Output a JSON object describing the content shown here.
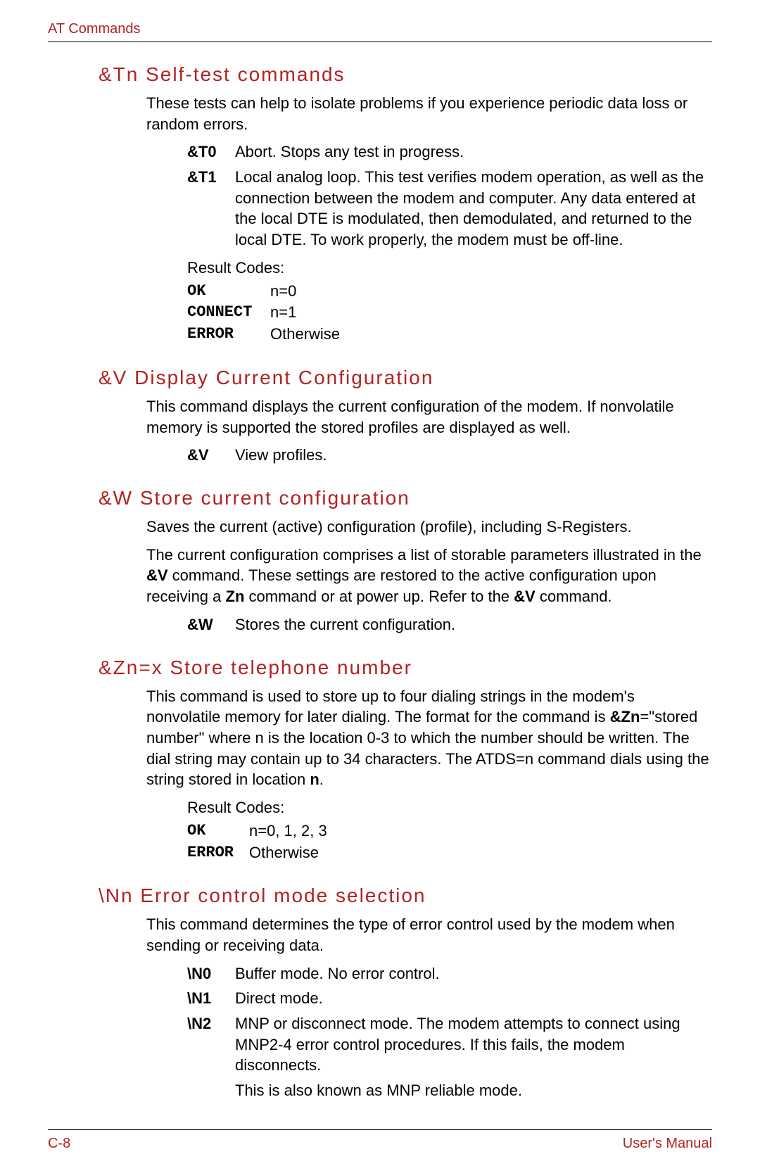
{
  "header": {
    "title": "AT Commands"
  },
  "footer": {
    "page": "C-8",
    "doc": "User's Manual"
  },
  "sections": {
    "tn": {
      "heading": "&Tn   Self-test commands",
      "intro": "These tests can help to isolate problems if you experience periodic data loss or random errors.",
      "items": [
        {
          "term": "&T0",
          "desc": "Abort. Stops any test in progress."
        },
        {
          "term": "&T1",
          "desc": "Local analog loop. This test verifies modem operation, as well as the connection between the modem and computer. Any data entered at the local DTE is modulated, then demodulated, and returned to the local DTE. To work properly, the modem must be off-line."
        }
      ],
      "result_label": "Result Codes:",
      "results": [
        {
          "code": "OK",
          "val": "n=0"
        },
        {
          "code": "CONNECT",
          "val": "n=1"
        },
        {
          "code": "ERROR",
          "val": "Otherwise"
        }
      ]
    },
    "v": {
      "heading": "&V    Display Current Configuration",
      "intro": "This command displays the current configuration of the modem. If nonvolatile memory is supported the stored profiles are displayed as well.",
      "items": [
        {
          "term": "&V",
          "desc": "View profiles."
        }
      ]
    },
    "w": {
      "heading": "&W   Store current configuration",
      "intro": "Saves the current (active) configuration (profile), including S-Registers.",
      "para2_pre": "The current configuration comprises a list of storable parameters illustrated in the ",
      "para2_b1": "&V",
      "para2_mid": " command. These settings are restored to the active configuration upon receiving a ",
      "para2_b2": "Zn",
      "para2_mid2": " command or at power up. Refer to the ",
      "para2_b3": "&V",
      "para2_end": " command.",
      "items": [
        {
          "term": "&W",
          "desc": "Stores the current configuration."
        }
      ]
    },
    "zn": {
      "heading": "&Zn=x   Store telephone number",
      "p_pre": "This command is used to store up to four dialing strings in the modem's nonvolatile memory for later dialing. The format for the command is ",
      "p_b1": "&Zn",
      "p_mid": "=\"stored number\" where n is the location 0-3 to which the number should be written. The dial string may contain up to 34 characters. The ATDS=n command dials using the string stored in location ",
      "p_b2": "n",
      "p_end": ".",
      "result_label": "Result Codes:",
      "results": [
        {
          "code": "OK",
          "val": "n=0, 1, 2, 3"
        },
        {
          "code": "ERROR",
          "val": "Otherwise"
        }
      ]
    },
    "nn": {
      "heading": "\\Nn    Error control mode selection",
      "intro": "This command determines the type of error control used by the modem when sending or receiving data.",
      "items": [
        {
          "term": "\\N0",
          "desc": "Buffer mode. No error control."
        },
        {
          "term": "\\N1",
          "desc": "Direct mode."
        },
        {
          "term": "\\N2",
          "desc": "MNP or disconnect mode. The modem attempts to connect using MNP2-4 error control procedures. If this fails, the modem disconnects."
        }
      ],
      "tail": "This is also known as MNP reliable mode."
    }
  }
}
